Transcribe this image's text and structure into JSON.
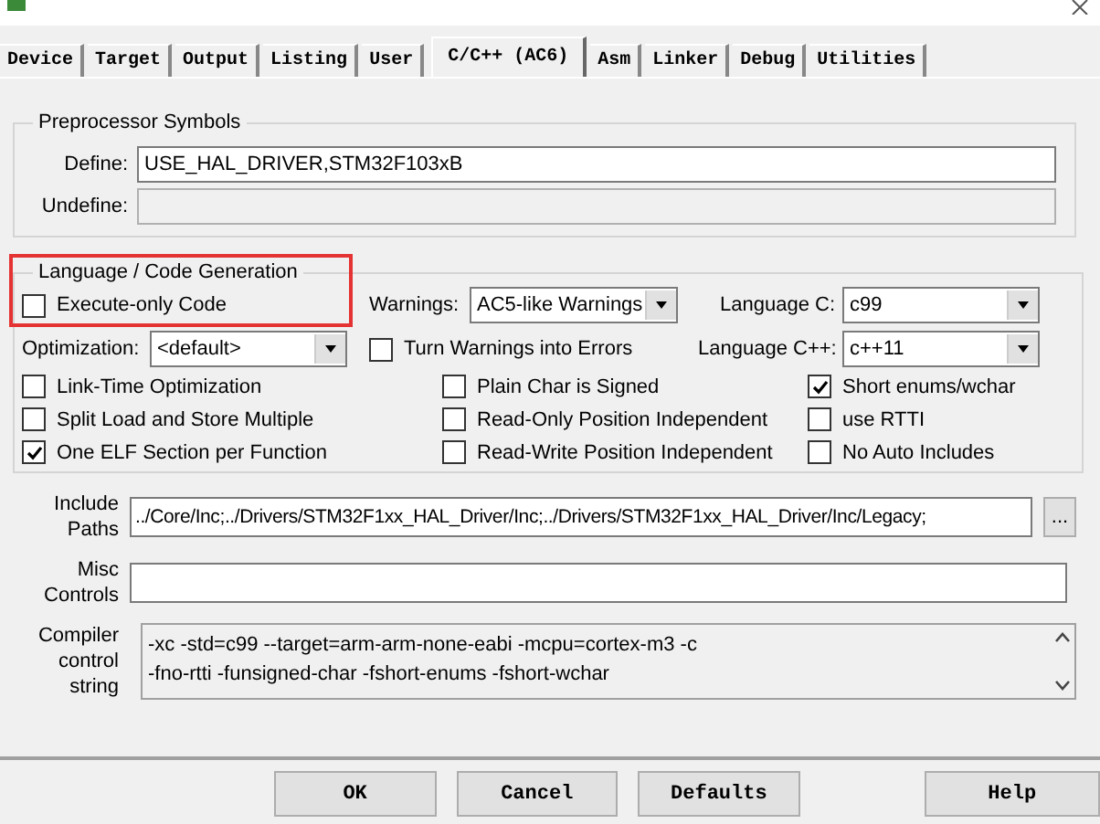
{
  "tabs": [
    {
      "label": "Device",
      "selected": false
    },
    {
      "label": "Target",
      "selected": false
    },
    {
      "label": "Output",
      "selected": false
    },
    {
      "label": "Listing",
      "selected": false
    },
    {
      "label": "User",
      "selected": false
    },
    {
      "label": "C/C++ (AC6)",
      "selected": true
    },
    {
      "label": "Asm",
      "selected": false
    },
    {
      "label": "Linker",
      "selected": false
    },
    {
      "label": "Debug",
      "selected": false
    },
    {
      "label": "Utilities",
      "selected": false
    }
  ],
  "preprocessor_symbols": {
    "title": "Preprocessor Symbols",
    "define": {
      "label": "Define:",
      "value": "USE_HAL_DRIVER,STM32F103xB"
    },
    "undefine": {
      "label": "Undefine:",
      "disabled": true
    }
  },
  "language_code_generation": {
    "title": "Language / Code Generation",
    "execute_only": {
      "label": "Execute-only Code",
      "checked": false
    },
    "warnings": {
      "label": "Warnings:",
      "value": "AC5-like Warnings"
    },
    "language_c": {
      "label": "Language C:",
      "value": "c99"
    },
    "optimization": {
      "label": "Optimization:",
      "value": "<default>"
    },
    "turn_warnings_into_errors": {
      "label": "Turn Warnings into Errors",
      "checked": false
    },
    "language_cpp": {
      "label": "Language C++:",
      "value": "c++11"
    },
    "options": [
      {
        "label": "Link-Time Optimization",
        "checked": false
      },
      {
        "label": "Plain Char is Signed",
        "checked": false
      },
      {
        "label": "Short enums/wchar",
        "checked": true
      },
      {
        "label": "Split Load and Store Multiple",
        "checked": false
      },
      {
        "label": "Read-Only Position Independent",
        "checked": false
      },
      {
        "label": "use RTTI",
        "checked": false
      },
      {
        "label": "One ELF Section per Function",
        "checked": true
      },
      {
        "label": "Read-Write Position Independent",
        "checked": false
      },
      {
        "label": "No Auto Includes",
        "checked": false
      }
    ]
  },
  "include_paths": {
    "label": "Include Paths",
    "value": "../Core/Inc;../Drivers/STM32F1xx_HAL_Driver/Inc;../Drivers/STM32F1xx_HAL_Driver/Inc/Legacy;",
    "browse": "..."
  },
  "misc_controls": {
    "label": "Misc Controls"
  },
  "compiler_control_string": {
    "label": "Compiler control string",
    "lines": [
      "-xc -std=c99 --target=arm-arm-none-eabi -mcpu=cortex-m3 -c",
      "-fno-rtti -funsigned-char -fshort-enums -fshort-wchar"
    ]
  },
  "buttons": [
    "OK",
    "Cancel",
    "Defaults",
    "Help"
  ]
}
